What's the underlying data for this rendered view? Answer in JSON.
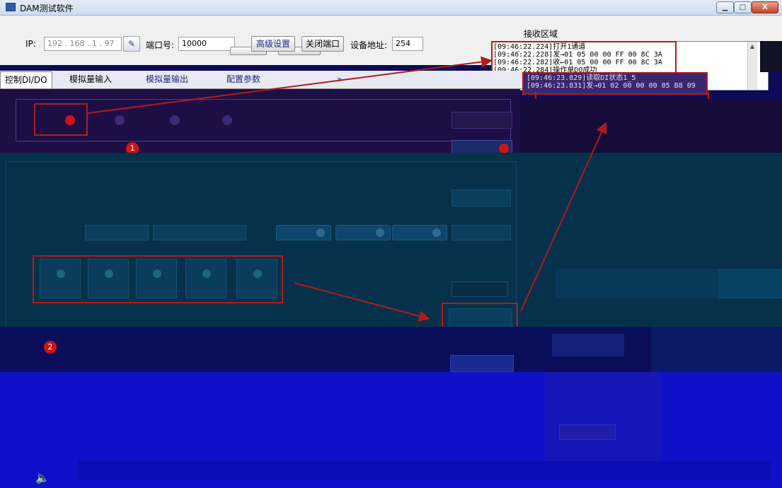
{
  "window": {
    "title": "DAM测试软件",
    "min_glyph": "▁",
    "max_glyph": "□",
    "close_glyph": "X"
  },
  "toolbar": {
    "ip_label": "IP:",
    "ip_value": "192 . 168 . 1 . 97",
    "edit_glyph": "✎",
    "port_label": "端口号:",
    "port_value": "10000",
    "advanced_label": "高级设置",
    "close_port_label": "关闭端口",
    "addr_label": "设备地址:",
    "addr_value": "254"
  },
  "receive": {
    "label": "接收区域",
    "lines": [
      "[09:46:22.224]打开1通道",
      "[09:46:22.228]发→01 05 00 00 FF 00 8C 3A",
      "[09:46:22.282]收←01 05 00 00 FF 00 8C 3A",
      "[09:46:22.284]操作单DO成功"
    ],
    "overlay_lines": [
      "[09:46:23.829]读取DI状态1_5",
      "[09:46:23.831]发→01 02 00 00 00 05 B8 09"
    ],
    "scroll_up_glyph": "▲"
  },
  "tabs": [
    {
      "label": "控制DI/DO"
    },
    {
      "label": "模拟量输入"
    },
    {
      "label": "模拟量输出"
    },
    {
      "label": "配置参数"
    },
    {
      "label": "»"
    }
  ],
  "badges": {
    "one": "1",
    "two": "2"
  },
  "footer": {
    "speaker_glyph": "🔈"
  },
  "colors": {
    "annotation_red": "#b11b1b",
    "led_on": "#d01414"
  }
}
